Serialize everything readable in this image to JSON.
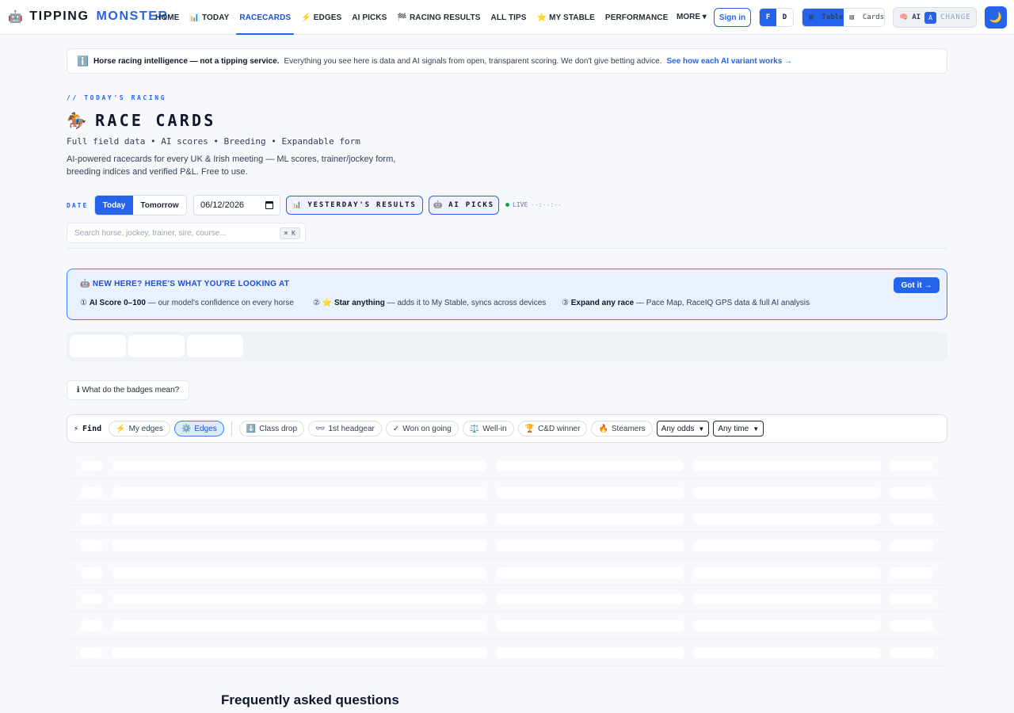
{
  "nav": {
    "logo_icon": "robot-emoji",
    "logo_word1": "TIPPING",
    "logo_word2": "MONSTER",
    "links": [
      {
        "icon": "",
        "label": "HOME"
      },
      {
        "icon": "📊",
        "label": "TODAY"
      },
      {
        "icon": "",
        "label": "RACECARDS",
        "active": true
      },
      {
        "icon": "⚡",
        "label": "EDGES"
      },
      {
        "icon": "",
        "label": "AI PICKS"
      },
      {
        "icon": "🏁",
        "label": "RACING RESULTS"
      },
      {
        "icon": "",
        "label": "ALL TIPS"
      },
      {
        "icon": "⭐",
        "label": "MY STABLE"
      },
      {
        "icon": "",
        "label": "PERFORMANCE"
      }
    ],
    "more_label": "MORE ▾",
    "signin_label": "Sign in",
    "odds_format": {
      "f": "F",
      "d": "D"
    },
    "view_toggle": {
      "table": "Table",
      "cards": "Cards"
    },
    "ai_chip": {
      "label": "AI",
      "variant": "A",
      "change": "CHANGE"
    },
    "theme_icon": "🌙"
  },
  "notice": {
    "icon": "ℹ️",
    "bold": "Horse racing intelligence — not a tipping service.",
    "text": "Everything you see here is data and AI signals from open, transparent scoring. We don't give betting advice.",
    "link": "See how each AI variant works →"
  },
  "hero": {
    "kicker": "// TODAY'S RACING",
    "title_icon": "🏇",
    "title": "RACE CARDS",
    "subtitle": "Full field data • AI scores • Breeding • Expandable form",
    "description": "AI-powered racecards for every UK & Irish meeting — ML scores, trainer/jockey form, breeding indices and verified P&L. Free to use."
  },
  "controls": {
    "date_label": "DATE",
    "today": "Today",
    "tomorrow": "Tomorrow",
    "date_value": "06/12/2026",
    "yesterday_icon": "📊",
    "yesterday": "YESTERDAY'S RESULTS",
    "ai_picks_icon": "🤖",
    "ai_picks": "AI PICKS",
    "live": "LIVE",
    "live_clock": "--:--:--",
    "search_placeholder": "Search horse, jockey, trainer, sire, course...",
    "search_kbd": "⌘ K"
  },
  "welcome": {
    "title": "🤖 NEW HERE? HERE'S WHAT YOU'RE LOOKING AT",
    "got_it": "Got it →",
    "tips": [
      {
        "num": "①",
        "bold": "AI Score 0–100",
        "text": "— our model's confidence on every horse"
      },
      {
        "num": "② ⭐",
        "bold": "Star anything",
        "text": "— adds it to My Stable, syncs across devices"
      },
      {
        "num": "③",
        "bold": "Expand any race",
        "text": "— Pace Map, RaceIQ GPS data & full AI analysis"
      }
    ]
  },
  "badges_help": "ℹ What do the badges mean?",
  "filters": {
    "find_icon": "⚡",
    "find_label": "Find",
    "pills": [
      {
        "icon": "⚡",
        "label": "My edges",
        "active": false
      },
      {
        "icon": "⚙️",
        "label": "Edges",
        "active": true
      },
      {
        "icon": "⬇️",
        "label": "Class drop",
        "active": false
      },
      {
        "icon": "👓",
        "label": "1st headgear",
        "active": false
      },
      {
        "icon": "✓",
        "label": "Won on going",
        "active": false
      },
      {
        "icon": "⚖️",
        "label": "Well-in",
        "active": false
      },
      {
        "icon": "🏆",
        "label": "C&D winner",
        "active": false
      },
      {
        "icon": "🔥",
        "label": "Steamers",
        "active": false
      }
    ],
    "odds_select": "Any odds",
    "time_select": "Any time"
  },
  "faq_title": "Frequently asked questions"
}
